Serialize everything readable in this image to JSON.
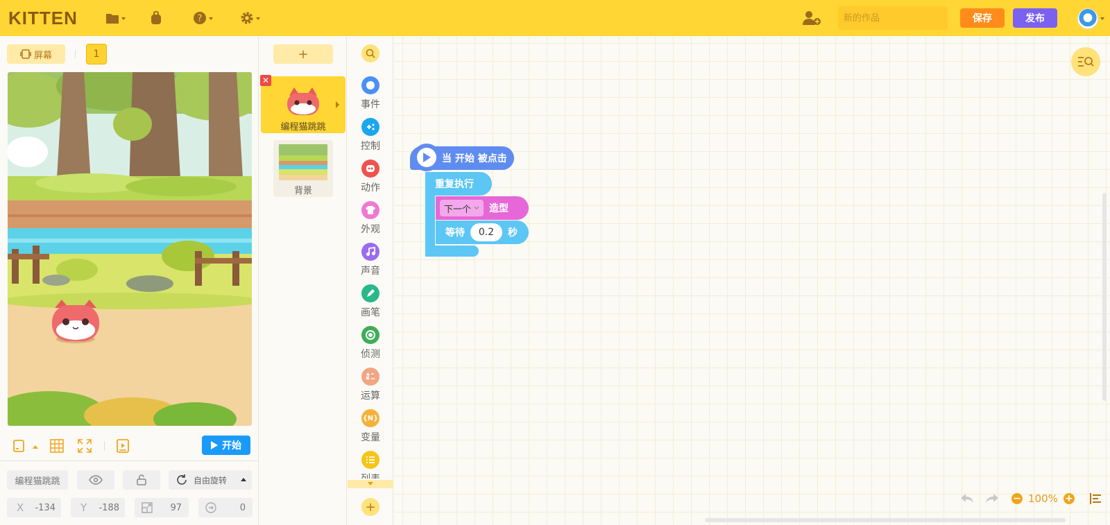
{
  "topbar": {
    "logo": "KITTEN",
    "work_name_placeholder": "新的作品",
    "save_label": "保存",
    "publish_label": "发布"
  },
  "stage_panel": {
    "screen_label": "屏幕",
    "screen_number": "1",
    "start_label": "开始",
    "sprite_name": "编程猫跳跳",
    "rotation_label": "自由旋转",
    "x_label": "X",
    "x_value": "-134",
    "y_label": "Y",
    "y_value": "-188",
    "size_value": "97",
    "direction_value": "0"
  },
  "sprite_panel": {
    "add_label": "+",
    "sprites": [
      {
        "name": "编程猫跳跳"
      }
    ],
    "background_label": "背景"
  },
  "categories": [
    {
      "label": "事件",
      "color": "#4a90f5",
      "icon": "event-icon"
    },
    {
      "label": "控制",
      "color": "#1aa7f0",
      "icon": "control-icon"
    },
    {
      "label": "动作",
      "color": "#ef5350",
      "icon": "action-icon"
    },
    {
      "label": "外观",
      "color": "#ef79d2",
      "icon": "looks-icon"
    },
    {
      "label": "声音",
      "color": "#9b6cf0",
      "icon": "sound-icon"
    },
    {
      "label": "画笔",
      "color": "#2ab78a",
      "icon": "pen-icon"
    },
    {
      "label": "侦测",
      "color": "#3ead58",
      "icon": "sensing-icon"
    },
    {
      "label": "运算",
      "color": "#f2a582",
      "icon": "operator-icon"
    },
    {
      "label": "变量",
      "color": "#f5b23a",
      "icon": "variable-icon"
    },
    {
      "label": "列表",
      "color": "#f5c518",
      "icon": "list-icon"
    }
  ],
  "blocks": {
    "hat_label": "当 开始 被点击",
    "repeat_label": "重复执行",
    "costume_dropdown": "下一个",
    "costume_label": "造型",
    "wait_label": "等待",
    "wait_value": "0.2",
    "wait_unit": "秒"
  },
  "workspace": {
    "zoom": "100%"
  },
  "colors": {
    "topbar": "#ffd633",
    "save": "#ff8c1a",
    "publish": "#7b61f2",
    "start": "#1a9bfc",
    "event_block": "#5f8cf0",
    "control_block": "#5cc6f5",
    "looks_block": "#e667d8"
  }
}
